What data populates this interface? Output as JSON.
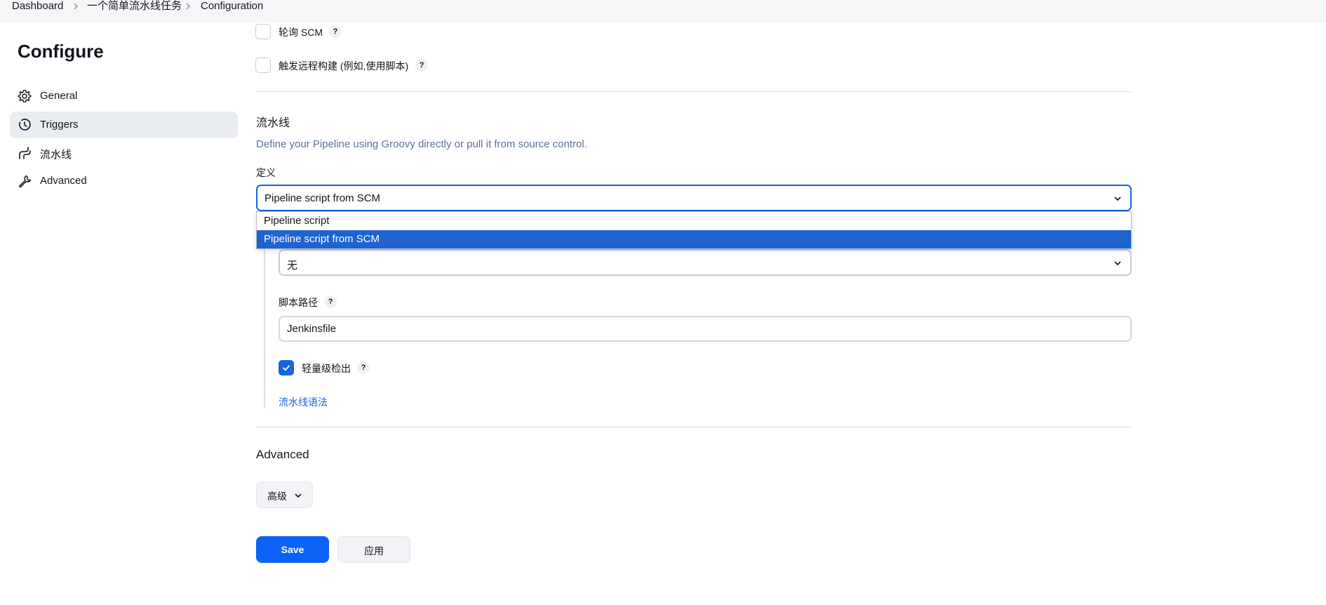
{
  "breadcrumb": {
    "items": [
      "Dashboard",
      "一个简单流水线任务",
      "Configuration"
    ]
  },
  "sidebar": {
    "title": "Configure",
    "items": [
      {
        "label": "General",
        "icon": "gear-icon",
        "active": false
      },
      {
        "label": "Triggers",
        "icon": "clock-icon",
        "active": true
      },
      {
        "label": "流水线",
        "icon": "pipeline-icon",
        "active": false
      },
      {
        "label": "Advanced",
        "icon": "wrench-icon",
        "active": false
      }
    ]
  },
  "triggers": {
    "poll_scm_label": "轮询 SCM",
    "remote_build_label": "触发远程构建 (例如,使用脚本)",
    "help_glyph": "?"
  },
  "pipeline": {
    "title": "流水线",
    "description": "Define your Pipeline using Groovy directly or pull it from source control.",
    "definition_label": "定义",
    "definition_selected": "Pipeline script from SCM",
    "definition_options": [
      "Pipeline script",
      "Pipeline script from SCM"
    ],
    "scm_selected": "无",
    "script_path_label": "脚本路径",
    "script_path_value": "Jenkinsfile",
    "lightweight_checkout_label": "轻量级检出",
    "lightweight_checkout_checked": true,
    "syntax_link": "流水线语法"
  },
  "advanced": {
    "title": "Advanced",
    "button_label": "高级"
  },
  "actions": {
    "save_label": "Save",
    "apply_label": "应用"
  },
  "colors": {
    "accent": "#0b62f5",
    "selected_option": "#1e63cf",
    "description_text": "#5a7299",
    "sidebar_active_bg": "#e9ecf1"
  }
}
